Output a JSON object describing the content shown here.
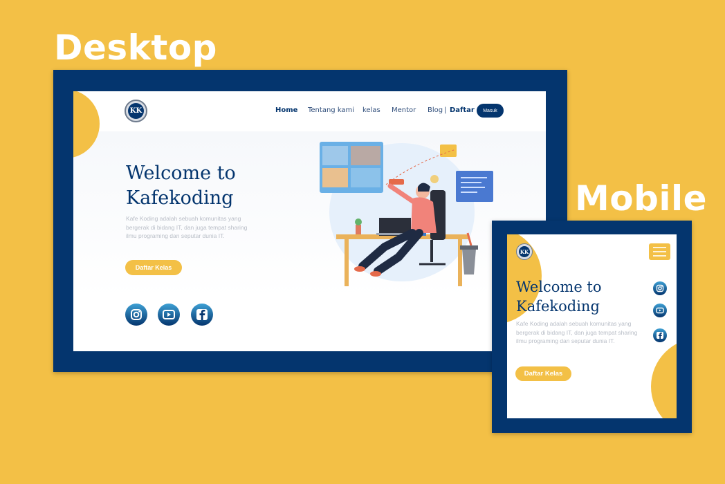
{
  "labels": {
    "desktop": "Desktop",
    "mobile": "Mobile"
  },
  "colors": {
    "background": "#F3C046",
    "navy": "#04356E",
    "accent": "#F3C046",
    "white": "#FFFFFF"
  },
  "desktop": {
    "logo_text": "KK",
    "nav": {
      "home": "Home",
      "tentang": "Tentang kami",
      "kelas": "kelas",
      "mentor": "Mentor",
      "blog": "Blog",
      "separator": "|",
      "daftar": "Daftar",
      "masuk": "Masuk"
    },
    "hero": {
      "title_line1": "Welcome to",
      "title_line2": "Kafekoding",
      "description": "Kafe Koding adalah sebuah komunitas yang bergerak di bidang IT, dan juga tempat sharing ilmu programing dan seputar dunia IT.",
      "cta": "Daftar Kelas"
    },
    "social_icons": [
      "instagram-icon",
      "youtube-icon",
      "facebook-icon"
    ]
  },
  "mobile": {
    "logo_text": "KK",
    "menu_icon": "hamburger-menu-icon",
    "hero": {
      "title_line1": "Welcome to",
      "title_line2": "Kafekoding",
      "description": "Kafe Koding adalah sebuah komunitas yang bergerak di bidang IT, dan juga tempat sharing ilmu programing dan seputar dunia IT.",
      "cta": "Daftar Kelas"
    },
    "social_icons": [
      "instagram-icon",
      "youtube-icon",
      "facebook-icon"
    ]
  }
}
